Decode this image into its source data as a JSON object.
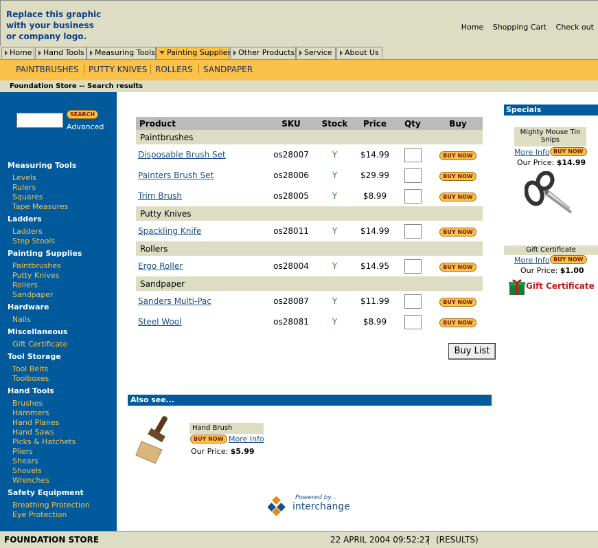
{
  "logo": {
    "line1": "Replace this graphic",
    "line2": "with your business",
    "line3": "or company logo."
  },
  "toplinks": [
    "Home",
    "Shopping Cart",
    "Check out"
  ],
  "tabs": [
    "Home",
    "Hand Tools",
    "Measuring Tools",
    "Painting Supplies",
    "Other Products",
    "Service",
    "About Us"
  ],
  "subnav": [
    "PAINTBRUSHES",
    "PUTTY KNIVES",
    "ROLLERS",
    "SANDPAPER"
  ],
  "crumb": "Foundation Store -- Search results",
  "search": {
    "button": "SEARCH",
    "advanced": "Advanced"
  },
  "sidebar": [
    {
      "cat": "Measuring Tools",
      "items": [
        "Levels",
        "Rulers",
        "Squares",
        "Tape Measures"
      ]
    },
    {
      "cat": "Ladders",
      "items": [
        "Ladders",
        "Step Stools"
      ]
    },
    {
      "cat": "Painting Supplies",
      "items": [
        "Paintbrushes",
        "Putty Knives",
        "Rollers",
        "Sandpaper"
      ]
    },
    {
      "cat": "Hardware",
      "items": [
        "Nails"
      ]
    },
    {
      "cat": "Miscellaneous",
      "items": [
        "Gift Certificate"
      ]
    },
    {
      "cat": "Tool Storage",
      "items": [
        "Tool Belts",
        "Toolboxes"
      ]
    },
    {
      "cat": "Hand Tools",
      "items": [
        "Brushes",
        "Hammers",
        "Hand Planes",
        "Hand Saws",
        "Picks & Hatchets",
        "Pliers",
        "Shears",
        "Shovels",
        "Wrenches"
      ]
    },
    {
      "cat": "Safety Equipment",
      "items": [
        "Breathing Protection",
        "Eye Protection"
      ]
    }
  ],
  "table": {
    "headers": [
      "Product",
      "SKU",
      "Stock",
      "Price",
      "Qty",
      "Buy"
    ],
    "groups": [
      {
        "name": "Paintbrushes",
        "rows": [
          [
            "Disposable Brush Set",
            "os28007",
            "Y",
            "$14.99"
          ],
          [
            "Painters Brush Set",
            "os28006",
            "Y",
            "$29.99"
          ],
          [
            "Trim Brush",
            "os28005",
            "Y",
            "$8.99"
          ]
        ]
      },
      {
        "name": "Putty Knives",
        "rows": [
          [
            "Spackling Knife",
            "os28011",
            "Y",
            "$14.99"
          ]
        ]
      },
      {
        "name": "Rollers",
        "rows": [
          [
            "Ergo Roller",
            "os28004",
            "Y",
            "$14.95"
          ]
        ]
      },
      {
        "name": "Sandpaper",
        "rows": [
          [
            "Sanders Multi-Pac",
            "os28087",
            "Y",
            "$11.99"
          ],
          [
            "Steel Wool",
            "os28081",
            "Y",
            "$8.99"
          ]
        ]
      }
    ],
    "buy_label": "BUY NOW"
  },
  "buylist": "Buy List",
  "also": {
    "title": "Also see...",
    "item": "Hand Brush",
    "buy": "BUY NOW",
    "more": "More Info",
    "price_label": "Our Price:",
    "price": "$5.99"
  },
  "powered": {
    "line1": "Powered by...",
    "line2": "interchange"
  },
  "specials": {
    "title": "Specials",
    "item1": {
      "name": "Mighty Mouse Tin Snips",
      "more": "More Info",
      "buy": "BUY NOW",
      "price_label": "Our Price:",
      "price": "$14.99"
    },
    "item2": {
      "name": "Gift Certificate",
      "more": "More Info",
      "buy": "BUY NOW",
      "price_label": "Our Price:",
      "price": "$1.00",
      "image_text": "Gift Certificate"
    }
  },
  "footer": {
    "store": "FOUNDATION STORE",
    "date": "22 APRIL 2004 09:52:27",
    "sep": "|",
    "status": "(RESULTS)"
  },
  "colors": {
    "nav_blue": "#005a9c",
    "accent_orange": "#fbc24a",
    "beige": "#ddddc4"
  }
}
